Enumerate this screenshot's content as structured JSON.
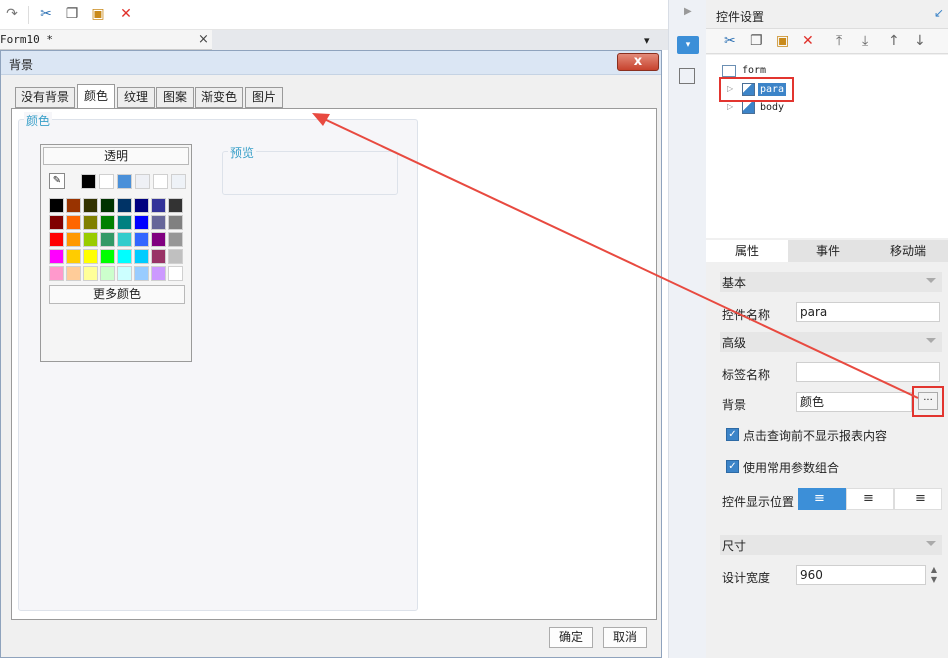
{
  "document": {
    "tab_title": "Form10 *",
    "tab_close": "×"
  },
  "dialog": {
    "title": "背景",
    "close_label": "x",
    "tabs": [
      {
        "label": "没有背景"
      },
      {
        "label": "颜色"
      },
      {
        "label": "纹理"
      },
      {
        "label": "图案"
      },
      {
        "label": "渐变色"
      },
      {
        "label": "图片"
      }
    ],
    "active_tab": "颜色",
    "group_label": "颜色",
    "picker": {
      "transparent_label": "透明",
      "recent_colors": [
        "#000000",
        "#ffffff",
        "#4a90d9",
        "#eef0f5",
        "#ffffff",
        "#eef2f7"
      ],
      "palette": [
        [
          "#000000",
          "#993300",
          "#333300",
          "#003300",
          "#003366",
          "#000080",
          "#333399",
          "#333333"
        ],
        [
          "#800000",
          "#ff6600",
          "#808000",
          "#008000",
          "#008080",
          "#0000ff",
          "#666699",
          "#808080"
        ],
        [
          "#ff0000",
          "#ff9900",
          "#99cc00",
          "#339966",
          "#33cccc",
          "#3366ff",
          "#800080",
          "#969696"
        ],
        [
          "#ff00ff",
          "#ffcc00",
          "#ffff00",
          "#00ff00",
          "#00ffff",
          "#00ccff",
          "#993366",
          "#c0c0c0"
        ],
        [
          "#ff99cc",
          "#ffcc99",
          "#ffff99",
          "#ccffcc",
          "#ccffff",
          "#99ccff",
          "#cc99ff",
          "#ffffff"
        ]
      ],
      "more_colors_label": "更多颜色"
    },
    "preview_label": "预览",
    "ok_label": "确定",
    "cancel_label": "取消"
  },
  "panel": {
    "title": "控件设置",
    "tree": [
      {
        "label": "form"
      },
      {
        "label": "para"
      },
      {
        "label": "body"
      }
    ],
    "tabs": [
      {
        "label": "属性"
      },
      {
        "label": "事件"
      },
      {
        "label": "移动端"
      }
    ],
    "sections": {
      "basic": "基本",
      "advanced": "高级",
      "size": "尺寸"
    },
    "fields": {
      "widget_name_label": "控件名称",
      "widget_name_value": "para",
      "tag_name_label": "标签名称",
      "tag_name_value": "",
      "background_label": "背景",
      "background_value": "颜色",
      "ellipsis": "···",
      "check1_label": "点击查询前不显示报表内容",
      "check2_label": "使用常用参数组合",
      "position_label": "控件显示位置",
      "width_label": "设计宽度",
      "width_value": "960"
    }
  },
  "colors": {
    "accent": "#3aa0c9",
    "highlight": "#e2352f",
    "selection": "#3c84c8"
  }
}
